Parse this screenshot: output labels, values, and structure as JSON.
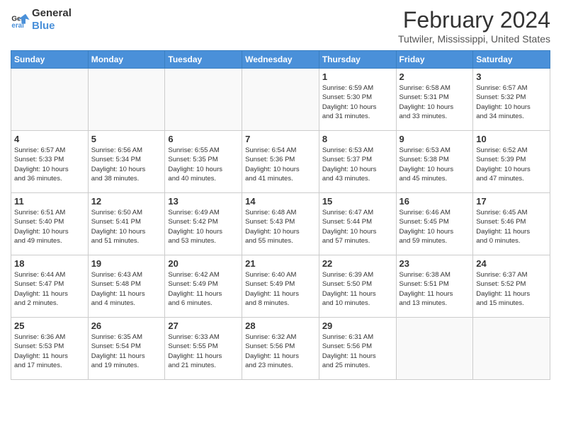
{
  "logo": {
    "line1": "General",
    "line2": "Blue"
  },
  "title": "February 2024",
  "location": "Tutwiler, Mississippi, United States",
  "weekdays": [
    "Sunday",
    "Monday",
    "Tuesday",
    "Wednesday",
    "Thursday",
    "Friday",
    "Saturday"
  ],
  "weeks": [
    [
      {
        "day": "",
        "info": "",
        "empty": true
      },
      {
        "day": "",
        "info": "",
        "empty": true
      },
      {
        "day": "",
        "info": "",
        "empty": true
      },
      {
        "day": "",
        "info": "",
        "empty": true
      },
      {
        "day": "1",
        "info": "Sunrise: 6:59 AM\nSunset: 5:30 PM\nDaylight: 10 hours\nand 31 minutes."
      },
      {
        "day": "2",
        "info": "Sunrise: 6:58 AM\nSunset: 5:31 PM\nDaylight: 10 hours\nand 33 minutes."
      },
      {
        "day": "3",
        "info": "Sunrise: 6:57 AM\nSunset: 5:32 PM\nDaylight: 10 hours\nand 34 minutes."
      }
    ],
    [
      {
        "day": "4",
        "info": "Sunrise: 6:57 AM\nSunset: 5:33 PM\nDaylight: 10 hours\nand 36 minutes."
      },
      {
        "day": "5",
        "info": "Sunrise: 6:56 AM\nSunset: 5:34 PM\nDaylight: 10 hours\nand 38 minutes."
      },
      {
        "day": "6",
        "info": "Sunrise: 6:55 AM\nSunset: 5:35 PM\nDaylight: 10 hours\nand 40 minutes."
      },
      {
        "day": "7",
        "info": "Sunrise: 6:54 AM\nSunset: 5:36 PM\nDaylight: 10 hours\nand 41 minutes."
      },
      {
        "day": "8",
        "info": "Sunrise: 6:53 AM\nSunset: 5:37 PM\nDaylight: 10 hours\nand 43 minutes."
      },
      {
        "day": "9",
        "info": "Sunrise: 6:53 AM\nSunset: 5:38 PM\nDaylight: 10 hours\nand 45 minutes."
      },
      {
        "day": "10",
        "info": "Sunrise: 6:52 AM\nSunset: 5:39 PM\nDaylight: 10 hours\nand 47 minutes."
      }
    ],
    [
      {
        "day": "11",
        "info": "Sunrise: 6:51 AM\nSunset: 5:40 PM\nDaylight: 10 hours\nand 49 minutes."
      },
      {
        "day": "12",
        "info": "Sunrise: 6:50 AM\nSunset: 5:41 PM\nDaylight: 10 hours\nand 51 minutes."
      },
      {
        "day": "13",
        "info": "Sunrise: 6:49 AM\nSunset: 5:42 PM\nDaylight: 10 hours\nand 53 minutes."
      },
      {
        "day": "14",
        "info": "Sunrise: 6:48 AM\nSunset: 5:43 PM\nDaylight: 10 hours\nand 55 minutes."
      },
      {
        "day": "15",
        "info": "Sunrise: 6:47 AM\nSunset: 5:44 PM\nDaylight: 10 hours\nand 57 minutes."
      },
      {
        "day": "16",
        "info": "Sunrise: 6:46 AM\nSunset: 5:45 PM\nDaylight: 10 hours\nand 59 minutes."
      },
      {
        "day": "17",
        "info": "Sunrise: 6:45 AM\nSunset: 5:46 PM\nDaylight: 11 hours\nand 0 minutes."
      }
    ],
    [
      {
        "day": "18",
        "info": "Sunrise: 6:44 AM\nSunset: 5:47 PM\nDaylight: 11 hours\nand 2 minutes."
      },
      {
        "day": "19",
        "info": "Sunrise: 6:43 AM\nSunset: 5:48 PM\nDaylight: 11 hours\nand 4 minutes."
      },
      {
        "day": "20",
        "info": "Sunrise: 6:42 AM\nSunset: 5:49 PM\nDaylight: 11 hours\nand 6 minutes."
      },
      {
        "day": "21",
        "info": "Sunrise: 6:40 AM\nSunset: 5:49 PM\nDaylight: 11 hours\nand 8 minutes."
      },
      {
        "day": "22",
        "info": "Sunrise: 6:39 AM\nSunset: 5:50 PM\nDaylight: 11 hours\nand 10 minutes."
      },
      {
        "day": "23",
        "info": "Sunrise: 6:38 AM\nSunset: 5:51 PM\nDaylight: 11 hours\nand 13 minutes."
      },
      {
        "day": "24",
        "info": "Sunrise: 6:37 AM\nSunset: 5:52 PM\nDaylight: 11 hours\nand 15 minutes."
      }
    ],
    [
      {
        "day": "25",
        "info": "Sunrise: 6:36 AM\nSunset: 5:53 PM\nDaylight: 11 hours\nand 17 minutes."
      },
      {
        "day": "26",
        "info": "Sunrise: 6:35 AM\nSunset: 5:54 PM\nDaylight: 11 hours\nand 19 minutes."
      },
      {
        "day": "27",
        "info": "Sunrise: 6:33 AM\nSunset: 5:55 PM\nDaylight: 11 hours\nand 21 minutes."
      },
      {
        "day": "28",
        "info": "Sunrise: 6:32 AM\nSunset: 5:56 PM\nDaylight: 11 hours\nand 23 minutes."
      },
      {
        "day": "29",
        "info": "Sunrise: 6:31 AM\nSunset: 5:56 PM\nDaylight: 11 hours\nand 25 minutes."
      },
      {
        "day": "",
        "info": "",
        "empty": true
      },
      {
        "day": "",
        "info": "",
        "empty": true
      }
    ]
  ]
}
